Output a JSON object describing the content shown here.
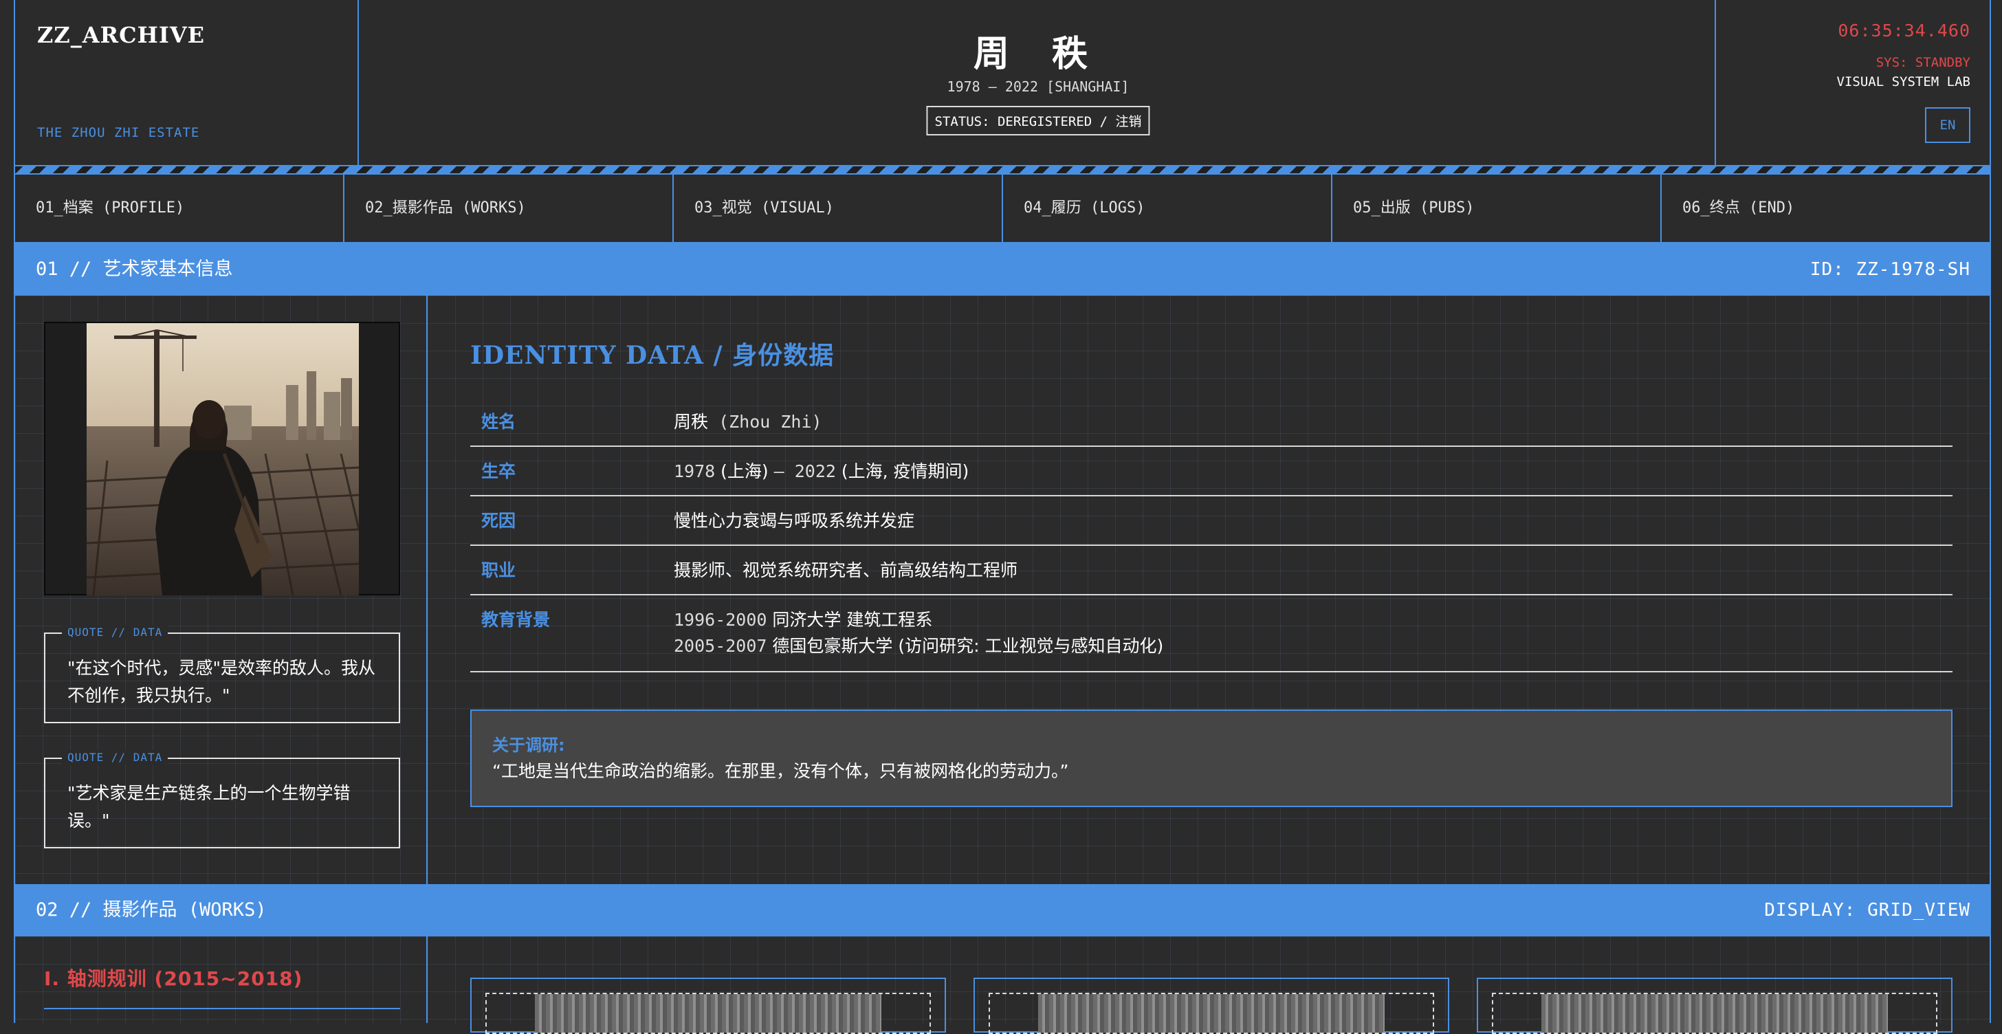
{
  "header": {
    "logo": "ZZ_ARCHIVE",
    "estate": "THE ZHOU ZHI ESTATE",
    "artist_name": "周 秩",
    "dates": "1978 — 2022 [SHANGHAI]",
    "status": "STATUS: DEREGISTERED / 注销",
    "clock": "06:35:34.460",
    "sys_status": "SYS: STANDBY",
    "lab": "VISUAL SYSTEM LAB",
    "lang_button": "EN"
  },
  "nav": {
    "items": [
      {
        "label": "01_档案 (PROFILE)"
      },
      {
        "label": "02_摄影作品 (WORKS)"
      },
      {
        "label": "03_视觉 (VISUAL)"
      },
      {
        "label": "04_履历 (LOGS)"
      },
      {
        "label": "05_出版 (PUBS)"
      },
      {
        "label": "06_终点 (END)"
      }
    ]
  },
  "section1": {
    "title": "01 // 艺术家基本信息",
    "id": "ID: ZZ-1978-SH"
  },
  "profile": {
    "quotes": [
      {
        "label": "QUOTE // DATA",
        "text": "\"在这个时代，灵感\"是效率的敌人。我从不创作，我只执行。\""
      },
      {
        "label": "QUOTE // DATA",
        "text": "\"艺术家是生产链条上的一个生物学错误。\""
      }
    ],
    "identity_title": "IDENTITY DATA / 身份数据",
    "rows": {
      "name": {
        "key": "姓名",
        "value": "周秩",
        "latin": " (Zhou Zhi)"
      },
      "life": {
        "key": "生卒",
        "y1": "1978",
        "p1": " (上海) ",
        "dash": "— 2022",
        "p2": " (上海, 疫情期间)"
      },
      "death": {
        "key": "死因",
        "value": "慢性心力衰竭与呼吸系统并发症"
      },
      "job": {
        "key": "职业",
        "value": "摄影师、视觉系统研究者、前高级结构工程师"
      },
      "edu": {
        "key": "教育背景",
        "lines": [
          {
            "years": "1996-2000",
            "text": " 同济大学 建筑工程系"
          },
          {
            "years": "2005-2007",
            "text": " 德国包豪斯大学 (访问研究: 工业视觉与感知自动化)"
          }
        ]
      }
    },
    "research": {
      "title": "关于调研:",
      "text": "“工地是当代生命政治的缩影。在那里，没有个体，只有被网格化的劳动力。”"
    }
  },
  "section2": {
    "title": "02 // 摄影作品 (WORKS)",
    "display": "DISPLAY: GRID_VIEW"
  },
  "works": {
    "series_title": "I. 轴测规训 (2015~2018)"
  },
  "colors": {
    "accent": "#4a90e2",
    "alert": "#e0484b",
    "background": "#2b2b2b"
  }
}
